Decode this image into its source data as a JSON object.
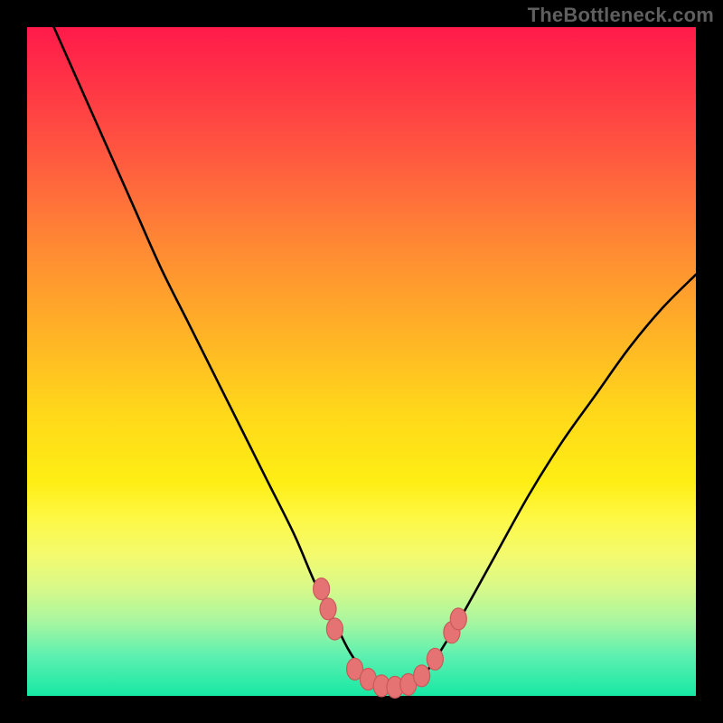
{
  "watermark": "TheBottleneck.com",
  "chart_data": {
    "type": "line",
    "title": "",
    "xlabel": "",
    "ylabel": "",
    "xlim": [
      0,
      100
    ],
    "ylim": [
      0,
      100
    ],
    "grid": false,
    "legend": false,
    "background_gradient": {
      "top": "#ff1a4a",
      "bottom": "#17e8a4",
      "stops": [
        "red",
        "orange",
        "yellow",
        "green"
      ]
    },
    "series": [
      {
        "name": "bottleneck-curve",
        "color": "#000000",
        "x": [
          4,
          8,
          12,
          16,
          20,
          24,
          28,
          32,
          36,
          40,
          43,
          46,
          48,
          50,
          52,
          54,
          56,
          58,
          60,
          62,
          65,
          70,
          75,
          80,
          85,
          90,
          95,
          100
        ],
        "values": [
          100,
          91,
          82,
          73,
          64,
          56,
          48,
          40,
          32,
          24,
          17,
          11,
          7,
          4,
          2,
          1,
          1,
          2,
          4,
          7,
          12,
          21,
          30,
          38,
          45,
          52,
          58,
          63
        ]
      }
    ],
    "markers": {
      "name": "highlight-points",
      "color": "#e57373",
      "points": [
        {
          "x": 44,
          "y": 16
        },
        {
          "x": 45,
          "y": 13
        },
        {
          "x": 46,
          "y": 10
        },
        {
          "x": 49,
          "y": 4
        },
        {
          "x": 51,
          "y": 2.5
        },
        {
          "x": 53,
          "y": 1.5
        },
        {
          "x": 55,
          "y": 1.3
        },
        {
          "x": 57,
          "y": 1.7
        },
        {
          "x": 59,
          "y": 3
        },
        {
          "x": 61,
          "y": 5.5
        },
        {
          "x": 63.5,
          "y": 9.5
        },
        {
          "x": 64.5,
          "y": 11.5
        }
      ]
    }
  }
}
